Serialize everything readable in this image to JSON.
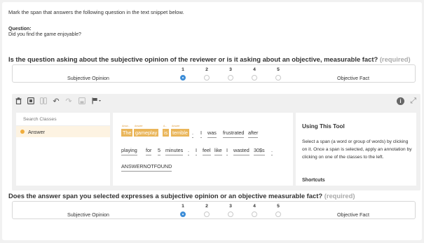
{
  "instruction": "Mark the span that answers the following question in the text snippet below.",
  "question": {
    "label": "Question:",
    "text": "Did you find the game enjoyable?"
  },
  "q1": {
    "heading": "Is the question asking about the subjective opinion of the reviewer or is it asking about an objective, measurable fact?",
    "required": "(required)",
    "left_label": "Subjective Opinion",
    "right_label": "Objective Fact",
    "options": [
      "1",
      "2",
      "3",
      "4",
      "5"
    ],
    "selected": "1"
  },
  "toolbar": {
    "icons": [
      "trash-icon",
      "expand-tokens-icon",
      "tokens-icon",
      "undo-icon",
      "redo-icon",
      "save-icon",
      "flag-icon"
    ],
    "info": "i"
  },
  "classes": {
    "search_placeholder": "Search Classes",
    "items": [
      {
        "label": "Answer",
        "color": "#f0ad3c"
      }
    ]
  },
  "text_snippet": {
    "spans": [
      {
        "text": "The",
        "tag": "Answ...",
        "selected": true
      },
      {
        "text": "gameplay",
        "tag": "Answer",
        "selected": true
      },
      {
        "text": "is",
        "tag": "A...",
        "selected": true
      },
      {
        "text": "terrible",
        "tag": "Answer",
        "selected": true
      }
    ],
    "line1_rest": [
      ".",
      "I",
      "was",
      "frustrated",
      "after"
    ],
    "line2": [
      "playing",
      "for",
      "5",
      "minutes",
      ".",
      "I",
      "feel",
      "like",
      "I",
      "wasted",
      "30$s",
      "."
    ],
    "not_found": "ANSWERNOTFOUND"
  },
  "help": {
    "title": "Using This Tool",
    "body": "Select a span (a word or group of words) by clicking on it. Once a span is selected, apply an annotation by clicking on one of the classes to the left.",
    "shortcuts": "Shortcuts"
  },
  "q2": {
    "heading": "Does the answer span you selected expresses a subjective opinion or an objective measurable fact?",
    "required": "(required)",
    "left_label": "Subjective Opinion",
    "right_label": "Objective Fact",
    "options": [
      "1",
      "2",
      "3",
      "4",
      "5"
    ],
    "selected": "1"
  },
  "colors": {
    "accent": "#3e8ed8",
    "highlight": "#eab65a",
    "class_dot": "#f0ad3c"
  }
}
